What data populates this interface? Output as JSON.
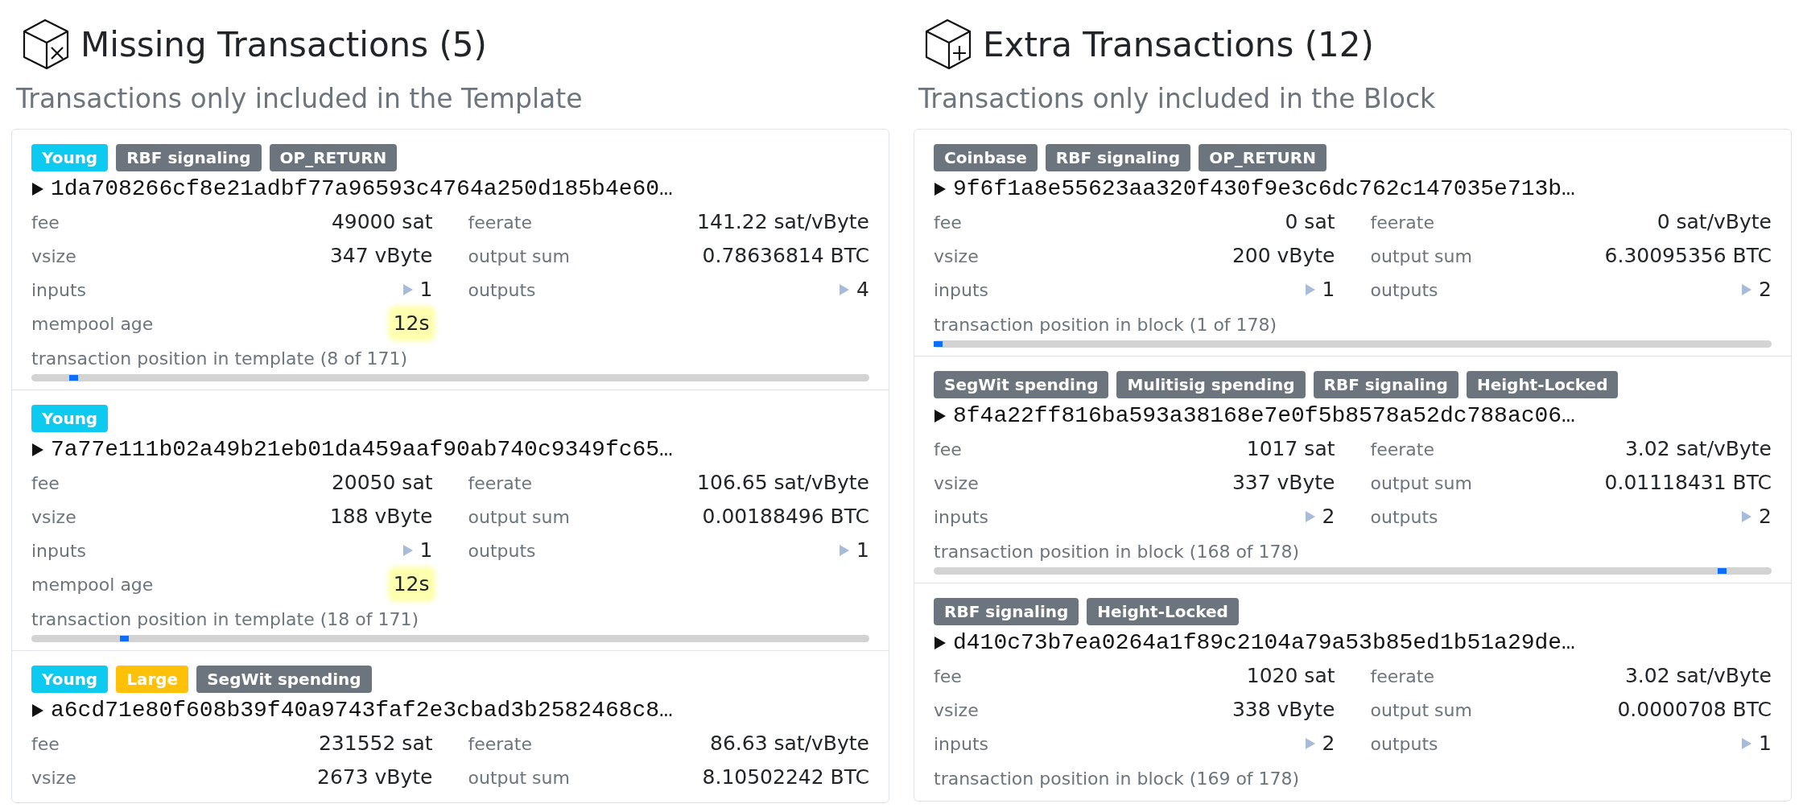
{
  "sections": [
    {
      "kind": "minus",
      "title": "Missing Transactions (5)",
      "subtitle": "Transactions only included in the Template",
      "transactions": [
        {
          "tags": [
            {
              "label": "Young",
              "color": "#0dcaf0"
            },
            {
              "label": "RBF signaling",
              "color": "#6c757d"
            },
            {
              "label": "OP_RETURN",
              "color": "#6c757d"
            }
          ],
          "txid": "1da708266cf8e21adbf77a96593c4764a250d185b4e60…",
          "left": [
            {
              "kind": "plain",
              "label": "fee",
              "value": "49000 sat"
            },
            {
              "kind": "plain",
              "label": "vsize",
              "value": "347 vByte"
            },
            {
              "kind": "count",
              "label": "inputs",
              "value": "1"
            },
            {
              "kind": "age",
              "label": "mempool age",
              "value": "12s"
            }
          ],
          "right": [
            {
              "kind": "plain",
              "label": "feerate",
              "value": "141.22 sat/vByte"
            },
            {
              "kind": "plain",
              "label": "output sum",
              "value": "0.78636814 BTC"
            },
            {
              "kind": "count",
              "label": "outputs",
              "value": "4"
            }
          ],
          "position": {
            "label": "transaction position in template (8 of 171)",
            "level": 0.05
          }
        },
        {
          "tags": [
            {
              "label": "Young",
              "color": "#0dcaf0"
            }
          ],
          "txid": "7a77e111b02a49b21eb01da459aaf90ab740c9349fc65…",
          "left": [
            {
              "kind": "plain",
              "label": "fee",
              "value": "20050 sat"
            },
            {
              "kind": "plain",
              "label": "vsize",
              "value": "188 vByte"
            },
            {
              "kind": "count",
              "label": "inputs",
              "value": "1"
            },
            {
              "kind": "age",
              "label": "mempool age",
              "value": "12s"
            }
          ],
          "right": [
            {
              "kind": "plain",
              "label": "feerate",
              "value": "106.65 sat/vByte"
            },
            {
              "kind": "plain",
              "label": "output sum",
              "value": "0.00188496 BTC"
            },
            {
              "kind": "count",
              "label": "outputs",
              "value": "1"
            }
          ],
          "position": {
            "label": "transaction position in template (18 of 171)",
            "level": 0.11
          }
        },
        {
          "tags": [
            {
              "label": "Young",
              "color": "#0dcaf0"
            },
            {
              "label": "Large",
              "color": "#ffc107"
            },
            {
              "label": "SegWit spending",
              "color": "#6c757d"
            }
          ],
          "txid": "a6cd71e80f608b39f40a9743faf2e3cbad3b2582468c8…",
          "left": [
            {
              "kind": "plain",
              "label": "fee",
              "value": "231552 sat"
            },
            {
              "kind": "plain",
              "label": "vsize",
              "value": "2673 vByte"
            }
          ],
          "right": [
            {
              "kind": "plain",
              "label": "feerate",
              "value": "86.63 sat/vByte"
            },
            {
              "kind": "plain",
              "label": "output sum",
              "value": "8.10502242 BTC"
            }
          ]
        }
      ]
    },
    {
      "kind": "plus",
      "title": "Extra Transactions (12)",
      "subtitle": "Transactions only included in the Block",
      "transactions": [
        {
          "tags": [
            {
              "label": "Coinbase",
              "color": "#6c757d"
            },
            {
              "label": "RBF signaling",
              "color": "#6c757d"
            },
            {
              "label": "OP_RETURN",
              "color": "#6c757d"
            }
          ],
          "txid": "9f6f1a8e55623aa320f430f9e3c6dc762c147035e713b…",
          "left": [
            {
              "kind": "plain",
              "label": "fee",
              "value": "0 sat"
            },
            {
              "kind": "plain",
              "label": "vsize",
              "value": "200 vByte"
            },
            {
              "kind": "count",
              "label": "inputs",
              "value": "1"
            }
          ],
          "right": [
            {
              "kind": "plain",
              "label": "feerate",
              "value": "0 sat/vByte"
            },
            {
              "kind": "plain",
              "label": "output sum",
              "value": "6.30095356 BTC"
            },
            {
              "kind": "count",
              "label": "outputs",
              "value": "2"
            }
          ],
          "position": {
            "label": "transaction position in block (1 of 178)",
            "level": 0.005
          }
        },
        {
          "tags": [
            {
              "label": "SegWit spending",
              "color": "#6c757d"
            },
            {
              "label": "Mulitisig spending",
              "color": "#6c757d"
            },
            {
              "label": "RBF signaling",
              "color": "#6c757d"
            },
            {
              "label": "Height-Locked",
              "color": "#6c757d"
            }
          ],
          "txid": "8f4a22ff816ba593a38168e7e0f5b8578a52dc788ac06…",
          "left": [
            {
              "kind": "plain",
              "label": "fee",
              "value": "1017 sat"
            },
            {
              "kind": "plain",
              "label": "vsize",
              "value": "337 vByte"
            },
            {
              "kind": "count",
              "label": "inputs",
              "value": "2"
            }
          ],
          "right": [
            {
              "kind": "plain",
              "label": "feerate",
              "value": "3.02 sat/vByte"
            },
            {
              "kind": "plain",
              "label": "output sum",
              "value": "0.01118431 BTC"
            },
            {
              "kind": "count",
              "label": "outputs",
              "value": "2"
            }
          ],
          "position": {
            "label": "transaction position in block (168 of 178)",
            "level": 0.94
          }
        },
        {
          "tags": [
            {
              "label": "RBF signaling",
              "color": "#6c757d"
            },
            {
              "label": "Height-Locked",
              "color": "#6c757d"
            }
          ],
          "txid": "d410c73b7ea0264a1f89c2104a79a53b85ed1b51a29de…",
          "left": [
            {
              "kind": "plain",
              "label": "fee",
              "value": "1020 sat"
            },
            {
              "kind": "plain",
              "label": "vsize",
              "value": "338 vByte"
            },
            {
              "kind": "count",
              "label": "inputs",
              "value": "2"
            }
          ],
          "right": [
            {
              "kind": "plain",
              "label": "feerate",
              "value": "3.02 sat/vByte"
            },
            {
              "kind": "plain",
              "label": "output sum",
              "value": "0.0000708 BTC"
            },
            {
              "kind": "count",
              "label": "outputs",
              "value": "1"
            }
          ],
          "position": {
            "label": "transaction position in block (169 of 178)"
          }
        }
      ]
    }
  ]
}
